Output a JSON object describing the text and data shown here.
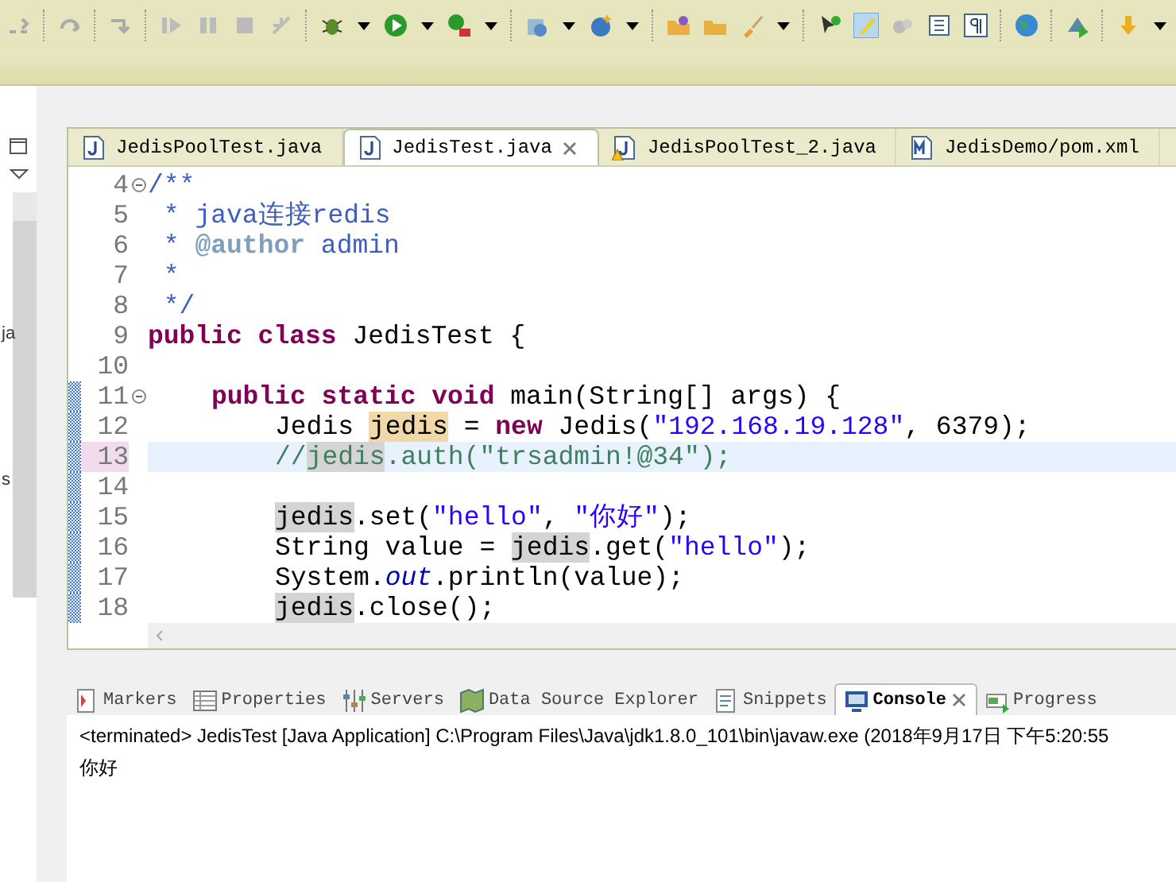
{
  "left_panel": {
    "fragments": [
      "ja",
      "s"
    ]
  },
  "editor_tabs": [
    {
      "label": "JedisPoolTest.java",
      "selected": false,
      "kind": "java",
      "warning": false
    },
    {
      "label": "JedisTest.java",
      "selected": true,
      "kind": "java",
      "warning": false
    },
    {
      "label": "JedisPoolTest_2.java",
      "selected": false,
      "kind": "java",
      "warning": true
    },
    {
      "label": "JedisDemo/pom.xml",
      "selected": false,
      "kind": "maven",
      "warning": false
    }
  ],
  "code_lines": [
    {
      "number": "4",
      "fold": true,
      "current": false,
      "changed": false,
      "tokens": [
        {
          "kind": "javadoc",
          "text": "/**"
        }
      ]
    },
    {
      "number": "5",
      "fold": false,
      "current": false,
      "changed": false,
      "tokens": [
        {
          "kind": "javadoc",
          "text": " * java连接redis"
        }
      ]
    },
    {
      "number": "6",
      "fold": false,
      "current": false,
      "changed": false,
      "tokens": [
        {
          "kind": "javadoc",
          "text": " * "
        },
        {
          "kind": "javadoc-tag",
          "text": "@author"
        },
        {
          "kind": "javadoc",
          "text": " admin"
        }
      ]
    },
    {
      "number": "7",
      "fold": false,
      "current": false,
      "changed": false,
      "tokens": [
        {
          "kind": "javadoc",
          "text": " *"
        }
      ]
    },
    {
      "number": "8",
      "fold": false,
      "current": false,
      "changed": false,
      "tokens": [
        {
          "kind": "javadoc",
          "text": " */"
        }
      ]
    },
    {
      "number": "9",
      "fold": false,
      "current": false,
      "changed": false,
      "tokens": [
        {
          "kind": "keyword",
          "text": "public class"
        },
        {
          "kind": "plain",
          "text": " JedisTest {"
        }
      ],
      "children": [
        {
          "number": "10",
          "fold": false,
          "current": false,
          "changed": false
        },
        {
          "number": "11",
          "fold": true,
          "current": false,
          "changed": true,
          "tokens": [
            {
              "kind": "keyword",
              "text": "public static void"
            },
            {
              "kind": "plain",
              "text": " main(String[] args) {"
            }
          ],
          "children": [
            {
              "number": "12",
              "fold": false,
              "current": false,
              "changed": true,
              "tokens": [
                {
                  "kind": "plain",
                  "text": "Jedis "
                },
                {
                  "kind": "write-occurrence",
                  "text": "jedis"
                },
                {
                  "kind": "plain",
                  "text": " = "
                },
                {
                  "kind": "keyword",
                  "text": "new"
                },
                {
                  "kind": "plain",
                  "text": " Jedis("
                },
                {
                  "kind": "string",
                  "text": "\"192.168.19.128\""
                },
                {
                  "kind": "plain",
                  "text": ", 6379);"
                }
              ]
            },
            {
              "number": "13",
              "fold": false,
              "current": true,
              "changed": true,
              "tokens": [
                {
                  "kind": "comment",
                  "text": "//"
                },
                {
                  "kind": "comment-occurrence",
                  "text": "jedis"
                },
                {
                  "kind": "comment",
                  "text": ".auth(\"trsadmin!@34\");"
                }
              ]
            },
            {
              "number": "14",
              "fold": false,
              "current": false,
              "changed": true
            },
            {
              "number": "15",
              "fold": false,
              "current": false,
              "changed": true,
              "tokens": [
                {
                  "kind": "occurrence",
                  "text": "jedis"
                },
                {
                  "kind": "plain",
                  "text": ".set("
                },
                {
                  "kind": "string",
                  "text": "\"hello\""
                },
                {
                  "kind": "plain",
                  "text": ", "
                },
                {
                  "kind": "string",
                  "text": "\"你好\""
                },
                {
                  "kind": "plain",
                  "text": ");"
                }
              ]
            },
            {
              "number": "16",
              "fold": false,
              "current": false,
              "changed": true,
              "tokens": [
                {
                  "kind": "plain",
                  "text": "String value = "
                },
                {
                  "kind": "occurrence",
                  "text": "jedis"
                },
                {
                  "kind": "plain",
                  "text": ".get("
                },
                {
                  "kind": "string",
                  "text": "\"hello\""
                },
                {
                  "kind": "plain",
                  "text": ");"
                }
              ]
            },
            {
              "number": "17",
              "fold": false,
              "current": false,
              "changed": true,
              "tokens": [
                {
                  "kind": "plain",
                  "text": "System."
                },
                {
                  "kind": "field",
                  "text": "out"
                },
                {
                  "kind": "plain",
                  "text": ".println(value);"
                }
              ]
            },
            {
              "number": "18",
              "fold": false,
              "current": false,
              "changed": true,
              "tokens": [
                {
                  "kind": "occurrence",
                  "text": "jedis"
                },
                {
                  "kind": "plain",
                  "text": ".close();"
                }
              ]
            }
          ]
        }
      ]
    }
  ],
  "bottom_tabs": [
    {
      "label": "Markers",
      "selected": false,
      "kind": "markers"
    },
    {
      "label": "Properties",
      "selected": false,
      "kind": "properties"
    },
    {
      "label": "Servers",
      "selected": false,
      "kind": "servers"
    },
    {
      "label": "Data Source Explorer",
      "selected": false,
      "kind": "datasource"
    },
    {
      "label": "Snippets",
      "selected": false,
      "kind": "snippets"
    },
    {
      "label": "Console",
      "selected": true,
      "kind": "console"
    },
    {
      "label": "Progress",
      "selected": false,
      "kind": "progress"
    }
  ],
  "console": {
    "status": "<terminated> JedisTest [Java Application] C:\\Program Files\\Java\\jdk1.8.0_101\\bin\\javaw.exe (2018年9月17日 下午5:20:55",
    "output": [
      "你好"
    ]
  }
}
